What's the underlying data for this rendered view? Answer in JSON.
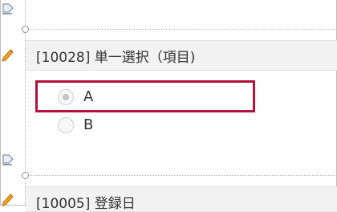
{
  "form": {
    "question1": {
      "title": "[10028] 単一選択（項目)"
    },
    "options": [
      {
        "label": "A",
        "selected": true
      },
      {
        "label": "B",
        "selected": false
      }
    ],
    "question2": {
      "title": "[10005] 登録日"
    }
  },
  "icons": {
    "drop": "drop-indicator-icon",
    "edit": "pencil-icon"
  },
  "colors": {
    "highlight": "#b5103a",
    "header_bg": "#f2f2f2",
    "pencil": "#f0a020"
  }
}
